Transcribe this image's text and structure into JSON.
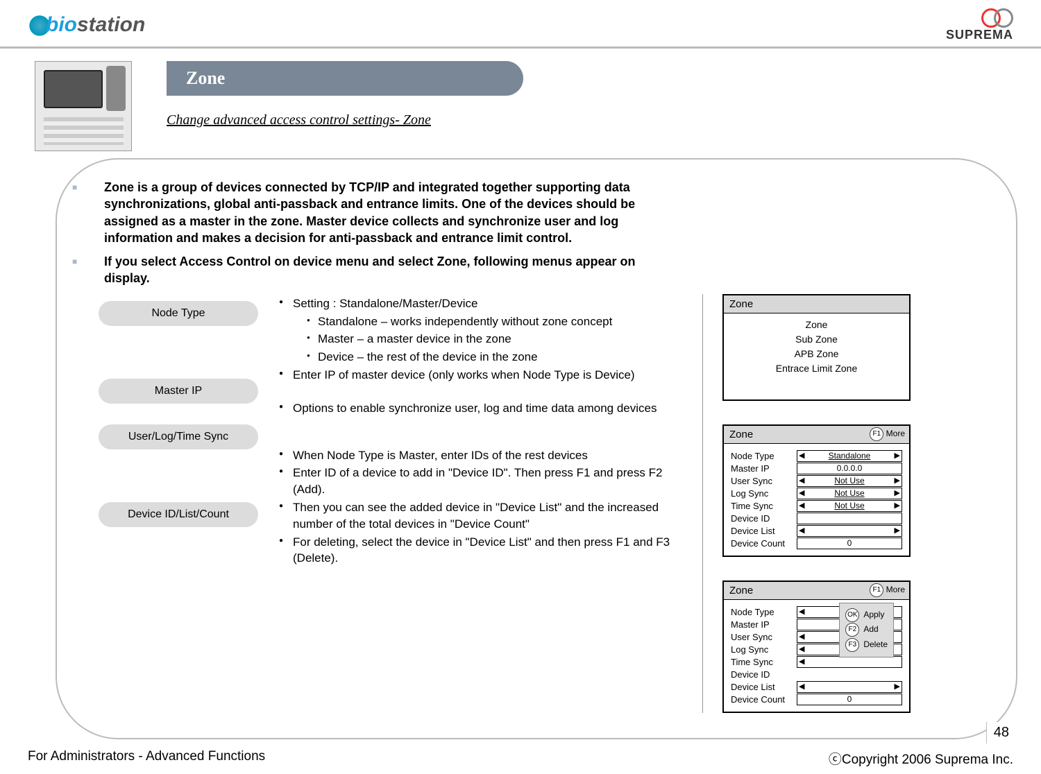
{
  "header": {
    "left_logo": "biostation",
    "right_logo": "SUPREMA"
  },
  "title": "Zone",
  "subtitle": "Change advanced access control settings- Zone",
  "intro": [
    "Zone is a group of devices connected by TCP/IP and integrated together supporting data synchronizations, global anti-passback and entrance limits. One of the devices should be assigned as a master in the zone. Master device collects and synchronize user and log information and makes a decision for anti-passback and entrance limit control.",
    "If you select Access Control on device menu and select Zone, following menus appear on display."
  ],
  "groups": {
    "node_type": "Node Type",
    "master_ip": "Master IP",
    "sync": "User/Log/Time Sync",
    "device": "Device ID/List/Count"
  },
  "node_type_lines": {
    "setting": "Setting : Standalone/Master/Device",
    "standalone": "Standalone – works independently without zone concept",
    "master": "Master – a master device in the zone",
    "device": "Device – the rest of the device in the zone"
  },
  "master_ip_line": "Enter IP of master device (only works when Node Type is Device)",
  "sync_line": "Options to enable synchronize user, log and time data among devices",
  "device_lines": {
    "l1": "When Node Type is Master, enter IDs of the rest devices",
    "l2": "Enter ID of a device to add in \"Device ID\". Then press F1 and press F2 (Add).",
    "l3": "Then you can see the added device in \"Device List\" and the increased number of the total devices in \"Device Count\"",
    "l4": "For deleting, select the device in \"Device List\" and then press F1 and F3 (Delete)."
  },
  "scr1": {
    "title": "Zone",
    "items": [
      "Zone",
      "Sub Zone",
      "APB Zone",
      "Entrace Limit Zone"
    ]
  },
  "scr2": {
    "title": "Zone",
    "more": "More",
    "f1": "F1",
    "rows": {
      "node_type": {
        "k": "Node Type",
        "v": "Standalone"
      },
      "master_ip": {
        "k": "Master IP",
        "v": "0.0.0.0"
      },
      "user_sync": {
        "k": "User Sync",
        "v": "Not Use"
      },
      "log_sync": {
        "k": "Log Sync",
        "v": "Not Use"
      },
      "time_sync": {
        "k": "Time Sync",
        "v": "Not Use"
      },
      "device_id": {
        "k": "Device ID",
        "v": ""
      },
      "device_list": {
        "k": "Device List",
        "v": ""
      },
      "device_count": {
        "k": "Device Count",
        "v": "0"
      }
    }
  },
  "scr3": {
    "title": "Zone",
    "more": "More",
    "f1": "F1",
    "popup": {
      "ok": "OK",
      "ok_label": "Apply",
      "f2": "F2",
      "f2_label": "Add",
      "f3": "F3",
      "f3_label": "Delete"
    },
    "rows": {
      "node_type": "Node Type",
      "master_ip": "Master IP",
      "user_sync": "User Sync",
      "log_sync": "Log Sync",
      "time_sync": "Time Sync",
      "device_id": "Device ID",
      "device_list": "Device List",
      "device_count_k": "Device Count",
      "device_count_v": "0"
    }
  },
  "page_number": "48",
  "footer": {
    "left": "For Administrators - Advanced Functions",
    "right": "ⓒCopyright 2006 Suprema Inc."
  }
}
